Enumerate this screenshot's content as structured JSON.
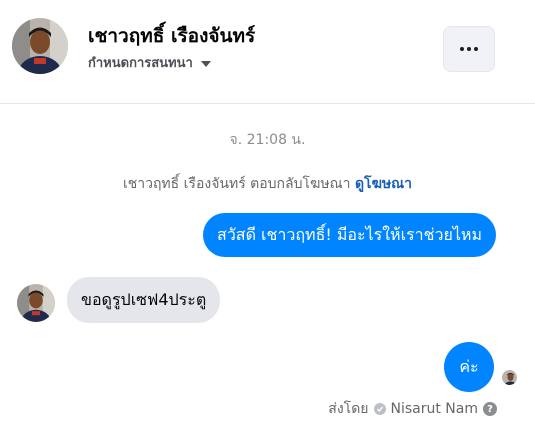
{
  "header": {
    "contact_name": "เชาวฤทธิ์ เรืองจันทร์",
    "manage_label": "กำหนดการสนทนา",
    "more_icon": "more-horizontal-icon"
  },
  "conversation": {
    "timestamp": "จ. 21:08 น.",
    "ad_reply_text": "เชาวฤทธิ์ เรืองจันทร์ ตอบกลับโฆษณา",
    "ad_link_label": "ดูโฆษณา",
    "messages": [
      {
        "direction": "outgoing",
        "text": "สวัสดี เชาวฤทธิ์! มีอะไรให้เราช่วยไหม"
      },
      {
        "direction": "incoming",
        "text": "ขอดูรูปเซฟ4ประตู"
      },
      {
        "direction": "outgoing",
        "text": "ค่ะ"
      }
    ],
    "sent_by_label": "ส่งโดย",
    "sender_name": "Nisarut Nam"
  },
  "colors": {
    "outgoing_bubble": "#0084ff",
    "incoming_bubble": "#e4e6eb",
    "link": "#1a5fb4"
  }
}
